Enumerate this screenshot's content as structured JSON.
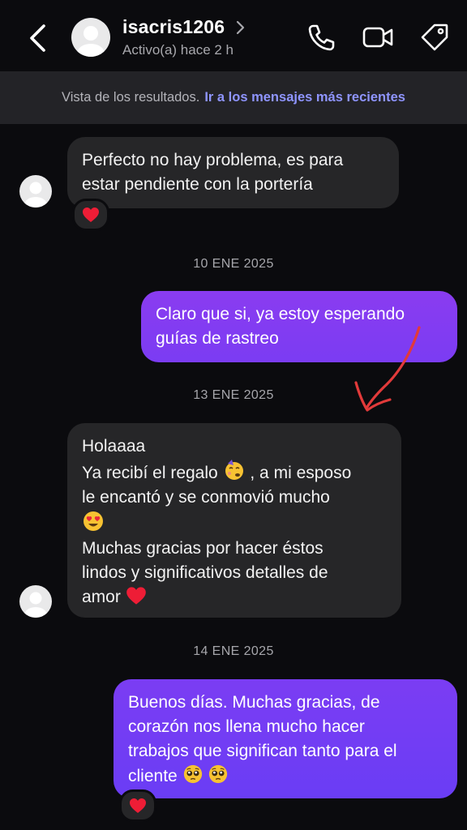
{
  "header": {
    "username": "isacris1206",
    "status": "Activo(a) hace 2 h"
  },
  "banner": {
    "text": "Vista de los resultados.",
    "link": "Ir a los mensajes más recientes"
  },
  "messages": [
    {
      "type": "incoming",
      "text": "Perfecto no hay problema, es para\nestar pendiente con la portería",
      "reaction": "heart"
    },
    {
      "type": "date",
      "text": "10 ENE 2025"
    },
    {
      "type": "outgoing",
      "text": "Claro que si, ya estoy esperando\nguías de rastreo"
    },
    {
      "type": "date",
      "text": "13 ENE 2025"
    },
    {
      "type": "incoming",
      "line1": "Holaaaa",
      "line2a": "Ya recibí el regalo",
      "line2b": ", a mi esposo",
      "line3": "le encantó y se conmovió mucho",
      "line5": "Muchas gracias por hacer éstos",
      "line6": "lindos y significativos detalles de",
      "line7": "amor"
    },
    {
      "type": "date",
      "text": "14 ENE 2025"
    },
    {
      "type": "outgoing",
      "text": "Buenos días. Muchas gracias, de\ncorazón nos llena mucho hacer\ntrabajos que significan tanto para el",
      "last_line": "cliente",
      "reaction": "heart"
    }
  ],
  "colors": {
    "outgoing_gradient_top": "#8a3cf0",
    "outgoing_gradient_bottom": "#6a3df5",
    "link": "#8f95ff",
    "annotation_arrow": "#e23a3a"
  },
  "icons": [
    "back-arrow-icon",
    "chevron-right-icon",
    "phone-icon",
    "video-icon",
    "tag-icon",
    "heart-icon",
    "smiling-face-with-hearts-icon",
    "heart-eyes-icon",
    "pleading-face-icon"
  ]
}
